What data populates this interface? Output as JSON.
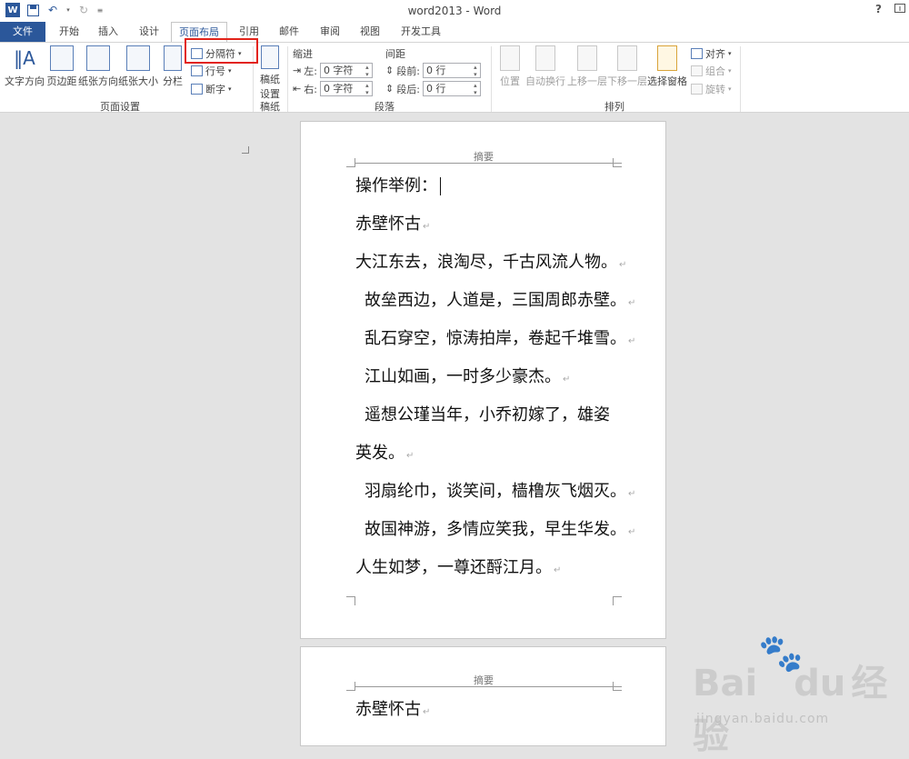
{
  "window": {
    "title": "word2013 - Word",
    "help": "?",
    "controls": [
      "restore-ribbon",
      "minimize",
      "restore",
      "close"
    ]
  },
  "tabs": [
    {
      "label": "文件",
      "active": false
    },
    {
      "label": "开始",
      "active": false
    },
    {
      "label": "插入",
      "active": false
    },
    {
      "label": "设计",
      "active": false
    },
    {
      "label": "页面布局",
      "active": true
    },
    {
      "label": "引用",
      "active": false
    },
    {
      "label": "邮件",
      "active": false
    },
    {
      "label": "审阅",
      "active": false
    },
    {
      "label": "视图",
      "active": false
    },
    {
      "label": "开发工具",
      "active": false
    }
  ],
  "ribbon": {
    "page_setup": {
      "text_direction": "文字方向",
      "margins": "页边距",
      "orientation": "纸张方向",
      "size": "纸张大小",
      "columns": "分栏",
      "breaks": "分隔符",
      "line_numbers": "行号",
      "hyphenation": "断字",
      "label": "页面设置"
    },
    "manuscript": {
      "settings_line1": "稿纸",
      "settings_line2": "设置",
      "label": "稿纸"
    },
    "paragraph": {
      "indent": "缩进",
      "spacing": "间距",
      "left_label": "左:",
      "left_value": "0 字符",
      "right_label": "右:",
      "right_value": "0 字符",
      "before_label": "段前:",
      "before_value": "0 行",
      "after_label": "段后:",
      "after_value": "0 行",
      "label": "段落"
    },
    "arrange": {
      "position": "位置",
      "wrap_text": "自动换行",
      "bring_forward": "上移一层",
      "send_backward": "下移一层",
      "selection_pane": "选择窗格",
      "align": "对齐",
      "group": "组合",
      "rotate": "旋转",
      "label": "排列"
    }
  },
  "document": {
    "page1": {
      "header": "摘要",
      "lines": [
        "操作举例：",
        "赤壁怀古",
        "大江东去，浪淘尽，千古风流人物。",
        "故垒西边，人道是，三国周郎赤壁。",
        "乱石穿空，惊涛拍岸，卷起千堆雪。",
        "江山如画，一时多少豪杰。",
        "遥想公瑾当年，小乔初嫁了，雄姿",
        "英发。",
        "羽扇纶巾，谈笑间，樯橹灰飞烟灭。",
        "故国神游，多情应笑我，早生华发。",
        "人生如梦，一尊还酹江月。"
      ]
    },
    "page2": {
      "header": "摘要",
      "lines": [
        "赤壁怀古"
      ]
    }
  },
  "watermark": {
    "brand": "Bai",
    "brand2": "du",
    "cn": "经验",
    "url": "jingyan.baidu.com"
  }
}
